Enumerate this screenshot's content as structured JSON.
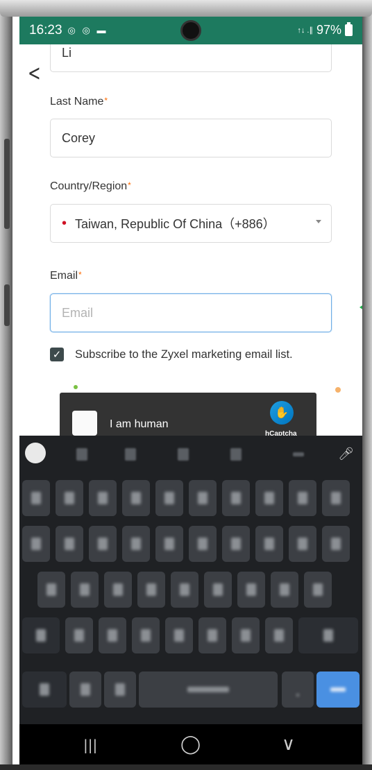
{
  "status_bar": {
    "time": "16:23",
    "left_icons": "◎ ◎ ▬",
    "network": "↑↓ .∥",
    "battery": "97%"
  },
  "form": {
    "first_name_value": "Li",
    "last_name_label": "Last Name",
    "last_name_value": "Corey",
    "country_label": "Country/Region",
    "country_value": "Taiwan, Republic Of China（+886）",
    "email_label": "Email",
    "email_placeholder": "Email",
    "required_marker": "*",
    "subscribe_text": "Subscribe to the Zyxel marketing email list.",
    "subscribe_checked": true
  },
  "captcha": {
    "label": "I am human",
    "brand": "hCaptcha"
  },
  "nav": {
    "back": "|||",
    "home": "◯",
    "recents": "∨"
  },
  "colors": {
    "status_bar_bg": "#1d7a5f",
    "required": "#ff6a00",
    "focus_border": "#6faee6",
    "keyboard_bg": "#1f2124",
    "enter_key": "#4a90e2"
  }
}
